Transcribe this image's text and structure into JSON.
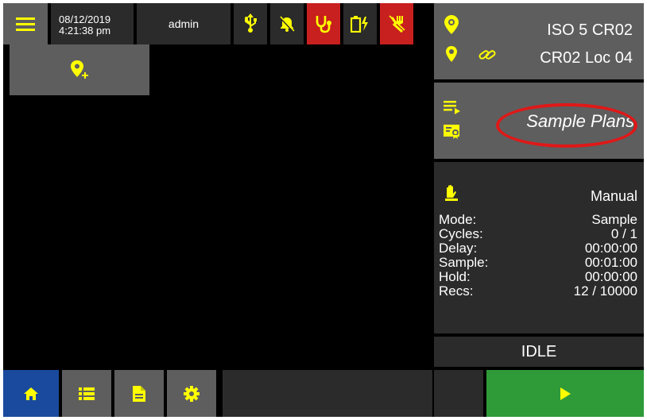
{
  "header": {
    "date": "08/12/2019",
    "time": "4:21:38 pm",
    "user": "admin"
  },
  "location": {
    "area": "ISO 5 CR02",
    "name": "CR02 Loc 04"
  },
  "sample_plans": {
    "label": "Sample Plans"
  },
  "info": {
    "control_mode": "Manual",
    "rows": [
      {
        "label": "Mode:",
        "value": "Sample"
      },
      {
        "label": "Cycles:",
        "value": "0 / 1"
      },
      {
        "label": "Delay:",
        "value": "00:00:00"
      },
      {
        "label": "Sample:",
        "value": "00:01:00"
      },
      {
        "label": "Hold:",
        "value": "00:00:00"
      },
      {
        "label": "Recs:",
        "value": "12 / 10000"
      }
    ]
  },
  "status": "IDLE",
  "icons": {
    "menu": "hamburger-menu-icon",
    "usb": "usb-icon",
    "alarm": "alarm-off-icon",
    "probe": "stethoscope-icon",
    "battery": "battery-charging-icon",
    "pump": "pump-fault-icon",
    "location": "location-pin-icon",
    "link": "link-icon",
    "add_location": "add-location-icon",
    "plan_list": "playlist-icon",
    "plan_badge": "plan-badge-icon",
    "hand": "hand-icon",
    "home": "home-icon",
    "list": "list-icon",
    "document": "document-icon",
    "settings": "gear-icon",
    "play": "play-icon"
  },
  "colors": {
    "accent": "#ffff00",
    "home_active": "#1a4a9e",
    "start": "#2f9a38",
    "alert": "#c8201e",
    "annotation": "#e01818"
  }
}
